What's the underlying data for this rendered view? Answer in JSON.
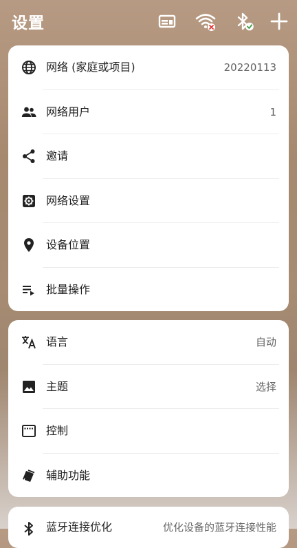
{
  "header": {
    "title": "设置",
    "icons": [
      "card-icon",
      "wifi-off-icon",
      "bluetooth-connected-icon",
      "plus-icon"
    ]
  },
  "section1": {
    "items": [
      {
        "icon": "globe-icon",
        "label": "网络 (家庭或项目)",
        "value": "20220113"
      },
      {
        "icon": "people-icon",
        "label": "网络用户",
        "value": "1"
      },
      {
        "icon": "share-icon",
        "label": "邀请",
        "value": ""
      },
      {
        "icon": "gear-icon",
        "label": "网络设置",
        "value": ""
      },
      {
        "icon": "location-pin-icon",
        "label": "设备位置",
        "value": ""
      },
      {
        "icon": "batch-list-icon",
        "label": "批量操作",
        "value": ""
      }
    ]
  },
  "section2": {
    "items": [
      {
        "icon": "translate-icon",
        "label": "语言",
        "value": "自动"
      },
      {
        "icon": "image-icon",
        "label": "主题",
        "value": "选择"
      },
      {
        "icon": "control-window-icon",
        "label": "控制",
        "value": ""
      },
      {
        "icon": "accessibility-cards-icon",
        "label": "辅助功能",
        "value": ""
      }
    ]
  },
  "section3": {
    "items": [
      {
        "icon": "bluetooth-icon",
        "label": "蓝牙连接优化",
        "value": "优化设备的蓝牙连接性能"
      }
    ]
  },
  "colors": {
    "text": "#222222",
    "secondary": "#666666",
    "card": "#ffffff",
    "badge_red": "#e53935",
    "badge_green": "#43a047"
  }
}
